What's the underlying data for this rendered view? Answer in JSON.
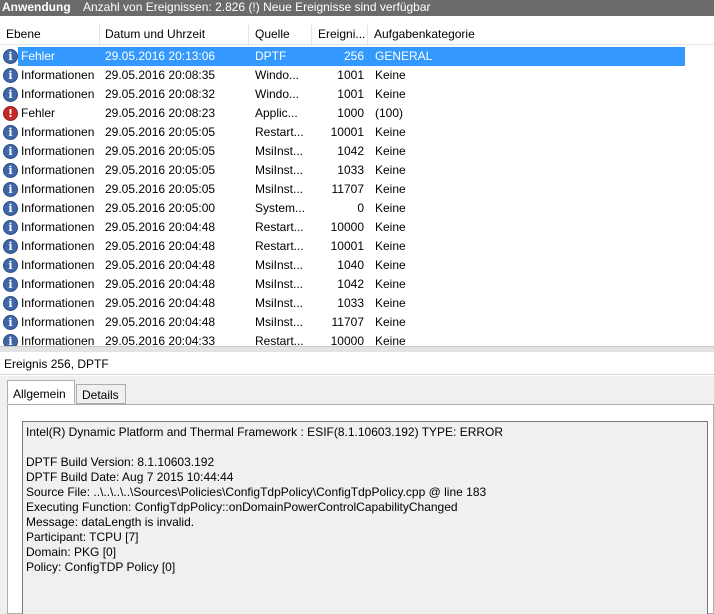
{
  "topbar": {
    "title": "Anwendung",
    "info": "Anzahl von Ereignissen: 2.826 (!) Neue Ereignisse sind verfügbar"
  },
  "columns": {
    "level": "Ebene",
    "date": "Datum und Uhrzeit",
    "source": "Quelle",
    "event_id": "Ereigni...",
    "category": "Aufgabenkategorie"
  },
  "rows": [
    {
      "icon": "information-icon",
      "level": "Fehler",
      "date": "29.05.2016 20:13:06",
      "source": "DPTF",
      "id": "256",
      "category": "GENERAL",
      "selected": true
    },
    {
      "icon": "information-icon",
      "level": "Informationen",
      "date": "29.05.2016 20:08:35",
      "source": "Windo...",
      "id": "1001",
      "category": "Keine"
    },
    {
      "icon": "information-icon",
      "level": "Informationen",
      "date": "29.05.2016 20:08:32",
      "source": "Windo...",
      "id": "1001",
      "category": "Keine"
    },
    {
      "icon": "error-icon",
      "level": "Fehler",
      "date": "29.05.2016 20:08:23",
      "source": "Applic...",
      "id": "1000",
      "category": "(100)"
    },
    {
      "icon": "information-icon",
      "level": "Informationen",
      "date": "29.05.2016 20:05:05",
      "source": "Restart...",
      "id": "10001",
      "category": "Keine"
    },
    {
      "icon": "information-icon",
      "level": "Informationen",
      "date": "29.05.2016 20:05:05",
      "source": "MsiInst...",
      "id": "1042",
      "category": "Keine"
    },
    {
      "icon": "information-icon",
      "level": "Informationen",
      "date": "29.05.2016 20:05:05",
      "source": "MsiInst...",
      "id": "1033",
      "category": "Keine"
    },
    {
      "icon": "information-icon",
      "level": "Informationen",
      "date": "29.05.2016 20:05:05",
      "source": "MsiInst...",
      "id": "11707",
      "category": "Keine"
    },
    {
      "icon": "information-icon",
      "level": "Informationen",
      "date": "29.05.2016 20:05:00",
      "source": "System...",
      "id": "0",
      "category": "Keine"
    },
    {
      "icon": "information-icon",
      "level": "Informationen",
      "date": "29.05.2016 20:04:48",
      "source": "Restart...",
      "id": "10000",
      "category": "Keine"
    },
    {
      "icon": "information-icon",
      "level": "Informationen",
      "date": "29.05.2016 20:04:48",
      "source": "Restart...",
      "id": "10001",
      "category": "Keine"
    },
    {
      "icon": "information-icon",
      "level": "Informationen",
      "date": "29.05.2016 20:04:48",
      "source": "MsiInst...",
      "id": "1040",
      "category": "Keine"
    },
    {
      "icon": "information-icon",
      "level": "Informationen",
      "date": "29.05.2016 20:04:48",
      "source": "MsiInst...",
      "id": "1042",
      "category": "Keine"
    },
    {
      "icon": "information-icon",
      "level": "Informationen",
      "date": "29.05.2016 20:04:48",
      "source": "MsiInst...",
      "id": "1033",
      "category": "Keine"
    },
    {
      "icon": "information-icon",
      "level": "Informationen",
      "date": "29.05.2016 20:04:48",
      "source": "MsiInst...",
      "id": "11707",
      "category": "Keine"
    },
    {
      "icon": "information-icon",
      "level": "Informationen",
      "date": "29.05.2016 20:04:33",
      "source": "Restart...",
      "id": "10000",
      "category": "Keine"
    }
  ],
  "event_title": "Ereignis 256, DPTF",
  "tabs": {
    "general": "Allgemein",
    "details": "Details"
  },
  "description_lines": [
    "Intel(R) Dynamic Platform and Thermal Framework : ESIF(8.1.10603.192) TYPE: ERROR",
    "",
    "DPTF Build Version:  8.1.10603.192",
    "DPTF Build Date:  Aug  7 2015 10:44:44",
    "Source File:  ..\\..\\..\\..\\Sources\\Policies\\ConfigTdpPolicy\\ConfigTdpPolicy.cpp @ line 183",
    "Executing Function:  ConfigTdpPolicy::onDomainPowerControlCapabilityChanged",
    "Message:  dataLength is invalid.",
    "Participant:  TCPU [7]",
    "Domain:  PKG [0]",
    "Policy:  ConfigTDP Policy [0]"
  ]
}
